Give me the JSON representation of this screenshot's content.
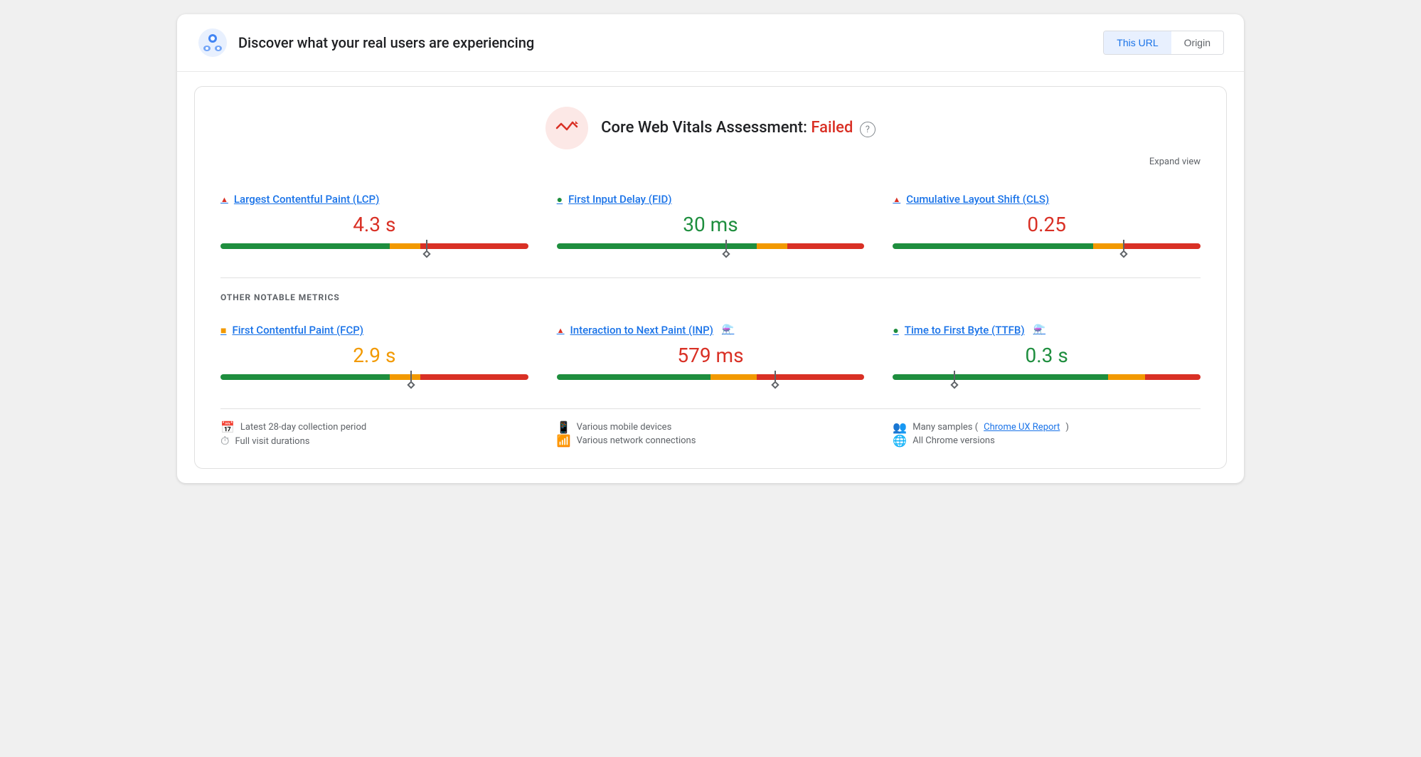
{
  "header": {
    "title": "Discover what your real users are experiencing",
    "this_url_label": "This URL",
    "origin_label": "Origin",
    "active_tab": "This URL"
  },
  "assessment": {
    "title_prefix": "Core Web Vitals Assessment: ",
    "status": "Failed",
    "expand_label": "Expand view"
  },
  "core_metrics": [
    {
      "id": "lcp",
      "status": "red",
      "status_icon": "▲",
      "label": "Largest Contentful Paint (LCP)",
      "value": "4.3 s",
      "value_color": "red",
      "bar": {
        "green": 55,
        "orange": 10,
        "red": 35,
        "marker": 67
      }
    },
    {
      "id": "fid",
      "status": "green",
      "status_icon": "●",
      "label": "First Input Delay (FID)",
      "value": "30 ms",
      "value_color": "green",
      "bar": {
        "green": 65,
        "orange": 10,
        "red": 25,
        "marker": 55
      }
    },
    {
      "id": "cls",
      "status": "red",
      "status_icon": "▲",
      "label": "Cumulative Layout Shift (CLS)",
      "value": "0.25",
      "value_color": "red",
      "bar": {
        "green": 65,
        "orange": 10,
        "red": 25,
        "marker": 75
      }
    }
  ],
  "other_metrics_title": "OTHER NOTABLE METRICS",
  "other_metrics": [
    {
      "id": "fcp",
      "status": "orange",
      "status_icon": "■",
      "label": "First Contentful Paint (FCP)",
      "value": "2.9 s",
      "value_color": "orange",
      "bar": {
        "green": 55,
        "orange": 10,
        "red": 35,
        "marker": 62
      },
      "experimental": false
    },
    {
      "id": "inp",
      "status": "red",
      "status_icon": "▲",
      "label": "Interaction to Next Paint (INP)",
      "value": "579 ms",
      "value_color": "red",
      "bar": {
        "green": 50,
        "orange": 15,
        "red": 35,
        "marker": 71
      },
      "experimental": true,
      "exp_icon": "🧪"
    },
    {
      "id": "ttfb",
      "status": "green",
      "status_icon": "●",
      "label": "Time to First Byte (TTFB)",
      "value": "0.3 s",
      "value_color": "green",
      "bar": {
        "green": 70,
        "orange": 12,
        "red": 18,
        "marker": 20
      },
      "experimental": true,
      "exp_icon": "🧪"
    }
  ],
  "footer": [
    [
      {
        "icon": "📅",
        "text": "Latest 28-day collection period"
      },
      {
        "icon": "⏱",
        "text": "Full visit durations"
      }
    ],
    [
      {
        "icon": "📱",
        "text": "Various mobile devices"
      },
      {
        "icon": "📶",
        "text": "Various network connections"
      }
    ],
    [
      {
        "icon": "👥",
        "text": "Many samples (",
        "link": "Chrome UX Report",
        "text_after": ")"
      },
      {
        "icon": "🌐",
        "text": "All Chrome versions"
      }
    ]
  ]
}
